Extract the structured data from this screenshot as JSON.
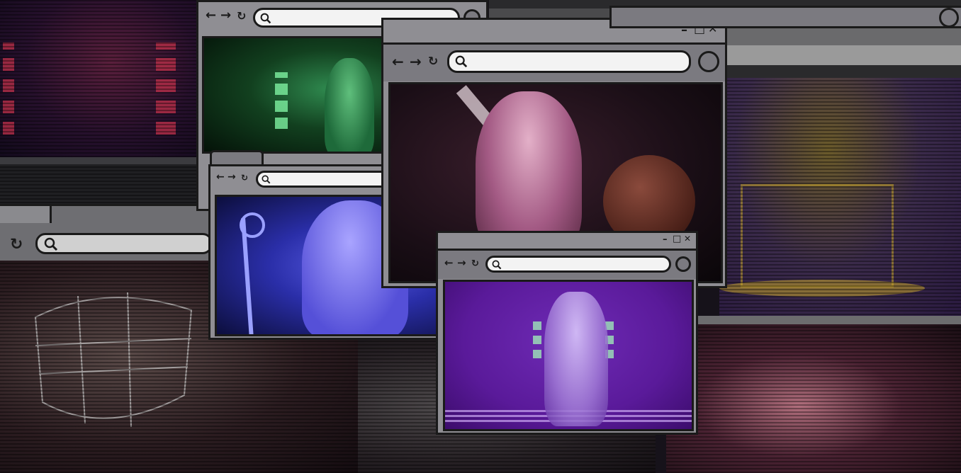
{
  "windows": {
    "main": {
      "minimize_icon": "minimize-icon",
      "maximize_icon": "maximize-icon",
      "close_icon": "close-icon"
    },
    "purple": {
      "minimize_icon": "minimize-icon",
      "maximize_icon": "maximize-icon",
      "close_icon": "close-icon"
    }
  },
  "icons": {
    "back": "←",
    "forward": "→",
    "reload": "↻",
    "minimize": "–",
    "maximize": "□",
    "close": "✕"
  },
  "colors": {
    "chrome": "#8f8e93",
    "border": "#1a1a1a",
    "url_bg": "#f3f3f3",
    "green_tint": "#1f8a45",
    "blue_tint": "#3a3fd0",
    "purple_tint": "#5a1a9a",
    "pink_tint": "#d68bc7"
  }
}
